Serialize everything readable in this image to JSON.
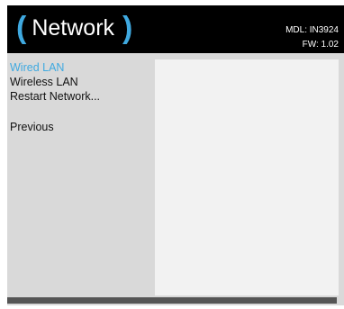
{
  "header": {
    "paren_open": "(",
    "title": "Network",
    "paren_close": ")",
    "model": "MDL: IN3924",
    "firmware": "FW: 1.02"
  },
  "menu": {
    "items": [
      {
        "label": "Wired LAN",
        "selected": true
      },
      {
        "label": "Wireless LAN",
        "selected": false
      },
      {
        "label": "Restart Network...",
        "selected": false
      }
    ],
    "previous": "Previous"
  },
  "colors": {
    "accent": "#3fa9e0",
    "header_bg": "#000000",
    "panel_bg": "#d9d9d9"
  }
}
